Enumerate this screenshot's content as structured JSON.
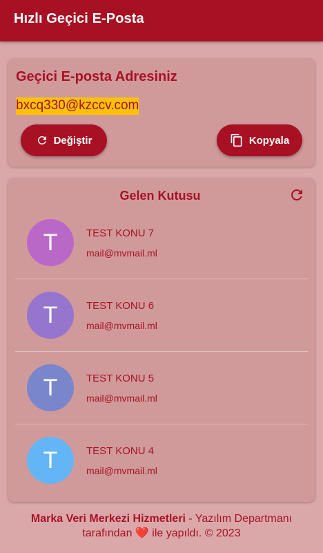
{
  "appbar": {
    "title": "Hızlı Geçici E-Posta"
  },
  "email_card": {
    "heading": "Geçici E-posta Adresiniz",
    "address": "bxcq330@kzccv.com",
    "change_label": "Değiştir",
    "copy_label": "Kopyala"
  },
  "inbox": {
    "heading": "Gelen Kutusu",
    "messages": [
      {
        "initial": "T",
        "subject": "TEST KONU 7",
        "from": "mail@mvmail.ml",
        "color": "#ba68c8"
      },
      {
        "initial": "T",
        "subject": "TEST KONU 6",
        "from": "mail@mvmail.ml",
        "color": "#9575cd"
      },
      {
        "initial": "T",
        "subject": "TEST KONU 5",
        "from": "mail@mvmail.ml",
        "color": "#7986cb"
      },
      {
        "initial": "T",
        "subject": "TEST KONU 4",
        "from": "mail@mvmail.ml",
        "color": "#64b5f6"
      }
    ]
  },
  "footer": {
    "brand": "Marka Veri Merkezi Hizmetleri",
    "text1": " - Yazılım Departmanı",
    "text2": "tarafından ",
    "heart": "❤️",
    "text3": " ile yapıldı. © 2023"
  },
  "colors": {
    "primary": "#a81123",
    "highlight": "#ffc107",
    "background": "#dba8aa",
    "card": "#d09a9b"
  }
}
